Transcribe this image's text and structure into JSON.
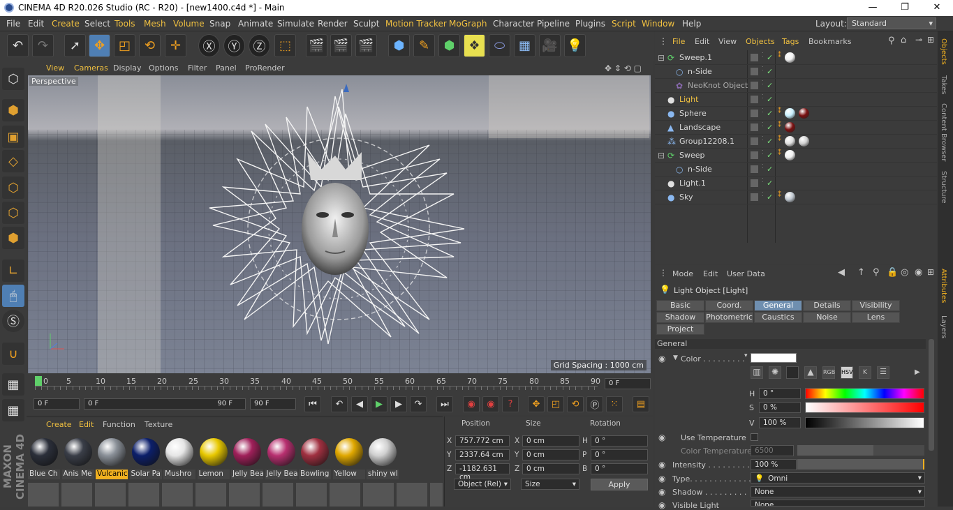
{
  "window": {
    "title": "CINEMA 4D R20.026 Studio (RC - R20) - [new1400.c4d *] - Main",
    "min": "—",
    "max": "❐",
    "close": "✕"
  },
  "menu": [
    "File",
    "Edit",
    "Create",
    "Select",
    "Tools",
    "Mesh",
    "Volume",
    "Snap",
    "Animate",
    "Simulate",
    "Render",
    "Sculpt",
    "Motion Tracker",
    "MoGraph",
    "Character",
    "Pipeline",
    "Plugins",
    "Script",
    "Window",
    "Help"
  ],
  "layout": {
    "label": "Layout:",
    "value": "Standard"
  },
  "viewport": {
    "menu": [
      "View",
      "Cameras",
      "Display",
      "Options",
      "Filter",
      "Panel",
      "ProRender"
    ],
    "camera": "Perspective",
    "grid": "Grid Spacing : 1000 cm"
  },
  "timeline": {
    "ticks": [
      "0",
      "5",
      "10",
      "15",
      "20",
      "25",
      "30",
      "35",
      "40",
      "45",
      "50",
      "55",
      "60",
      "65",
      "70",
      "75",
      "80",
      "85",
      "90"
    ],
    "current": "0 F"
  },
  "transport": {
    "start": "0 F",
    "range_start": "0 F",
    "range_end": "90 F",
    "end": "90 F"
  },
  "materials": {
    "menu": [
      "Create",
      "Edit",
      "Function",
      "Texture"
    ],
    "items": [
      {
        "name": "Blue Ch",
        "color": "#2b2f3a"
      },
      {
        "name": "Anis Me",
        "color": "#3a3e48"
      },
      {
        "name": "Vulcanic",
        "color": "#8a9098"
      },
      {
        "name": "Solar Pa",
        "color": "#0c1f6a"
      },
      {
        "name": "Mushro",
        "color": "#e6e6e6"
      },
      {
        "name": "Lemon",
        "color": "#e8c800"
      },
      {
        "name": "Jelly Bea",
        "color": "#a0205a"
      },
      {
        "name": "Jelly Bea",
        "color": "#b83070"
      },
      {
        "name": "Bowling",
        "color": "#a03040"
      },
      {
        "name": "Yellow",
        "color": "#e0a800"
      },
      {
        "name": "shiny wl",
        "color": "#d0d0d0"
      }
    ]
  },
  "coords": {
    "headers": [
      "Position",
      "Size",
      "Rotation"
    ],
    "rows": [
      {
        "a": "X",
        "pos": "757.772 cm",
        "b": "X",
        "size": "0 cm",
        "c": "H",
        "rot": "0 °"
      },
      {
        "a": "Y",
        "pos": "2337.64 cm",
        "b": "Y",
        "size": "0 cm",
        "c": "P",
        "rot": "0 °"
      },
      {
        "a": "Z",
        "pos": "-1182.631 cm",
        "b": "Z",
        "size": "0 cm",
        "c": "B",
        "rot": "0 °"
      }
    ],
    "mode": "Object (Rel)",
    "sizemode": "Size",
    "apply": "Apply"
  },
  "objects": {
    "menu": [
      "File",
      "Edit",
      "View",
      "Objects",
      "Tags",
      "Bookmarks"
    ],
    "rows": [
      {
        "name": "Sweep.1",
        "indent": 0,
        "icon": "sweep-icon",
        "glyph": "⟳",
        "iconColor": "#5fd06a",
        "tags": [
          "#f0f0f0"
        ]
      },
      {
        "name": "n-Side",
        "indent": 1,
        "icon": "circle-spline-icon",
        "glyph": "○",
        "iconColor": "#8ab8f0",
        "tags": []
      },
      {
        "name": "NeoKnot Object",
        "indent": 1,
        "icon": "knot-icon",
        "glyph": "✿",
        "iconColor": "#8a6ab0",
        "tags": [],
        "dim": true
      },
      {
        "name": "Light",
        "indent": 0,
        "icon": "light-bulb-icon",
        "glyph": "●",
        "iconColor": "#e0e0e0",
        "tags": [],
        "hl": true
      },
      {
        "name": "Sphere",
        "indent": 0,
        "icon": "sphere-icon",
        "glyph": "●",
        "iconColor": "#8ab8f0",
        "tags": [
          "#c8f0ff",
          "#7a1010"
        ]
      },
      {
        "name": "Landscape",
        "indent": 0,
        "icon": "landscape-icon",
        "glyph": "▲",
        "iconColor": "#8ab8f0",
        "tags": [
          "#7a1010"
        ]
      },
      {
        "name": "Group12208.1",
        "indent": 0,
        "icon": "group-icon",
        "glyph": "⁂",
        "iconColor": "#8ab8f0",
        "tags": [
          "#e0e0e0",
          "#d0d0d0"
        ]
      },
      {
        "name": "Sweep",
        "indent": 0,
        "icon": "sweep-icon",
        "glyph": "⟳",
        "iconColor": "#5fd06a",
        "tags": [
          "#f0f0f0"
        ]
      },
      {
        "name": "n-Side",
        "indent": 1,
        "icon": "circle-spline-icon",
        "glyph": "○",
        "iconColor": "#8ab8f0",
        "tags": []
      },
      {
        "name": "Light.1",
        "indent": 0,
        "icon": "light-bulb-icon",
        "glyph": "●",
        "iconColor": "#e0e0e0",
        "tags": []
      },
      {
        "name": "Sky",
        "indent": 0,
        "icon": "sky-icon",
        "glyph": "●",
        "iconColor": "#8ab8f0",
        "tags": [
          "#c0c8d0"
        ]
      }
    ]
  },
  "attributes": {
    "menu": [
      "Mode",
      "Edit",
      "User Data"
    ],
    "title": "Light Object [Light]",
    "tabs1": [
      "Basic",
      "Coord.",
      "General",
      "Details",
      "Visibility"
    ],
    "tabs2": [
      "Shadow",
      "Photometric",
      "Caustics",
      "Noise",
      "Lens"
    ],
    "tabs3": [
      "Project"
    ],
    "activeTab": "General",
    "section": "General",
    "color_label": "Color . . . . . . . . .",
    "color_value": "#ffffff",
    "h_label": "H",
    "h_value": "0 °",
    "s_label": "S",
    "s_value": "0 %",
    "v_label": "V",
    "v_value": "100 %",
    "rgb": "RGB",
    "hsv": "HSV",
    "k": "K",
    "use_temp": "Use Temperature",
    "color_temp": "Color Temperature",
    "color_temp_value": "6500",
    "intensity_label": "Intensity . . . . . . . . .",
    "intensity_value": "100 %",
    "intensity_fraction": 1.0,
    "type_label": "Type. . . . . . . . . . . . .",
    "type_value": "Omni",
    "shadow_label": "Shadow . . . . . . . . .",
    "shadow_value": "None",
    "visible_label": "Visible Light",
    "visible_value": "None"
  },
  "right_tabs": [
    "Objects",
    "Takes",
    "Content Browser",
    "Structure",
    "Attributes",
    "Layers"
  ],
  "brand": "MAXON CINEMA 4D"
}
